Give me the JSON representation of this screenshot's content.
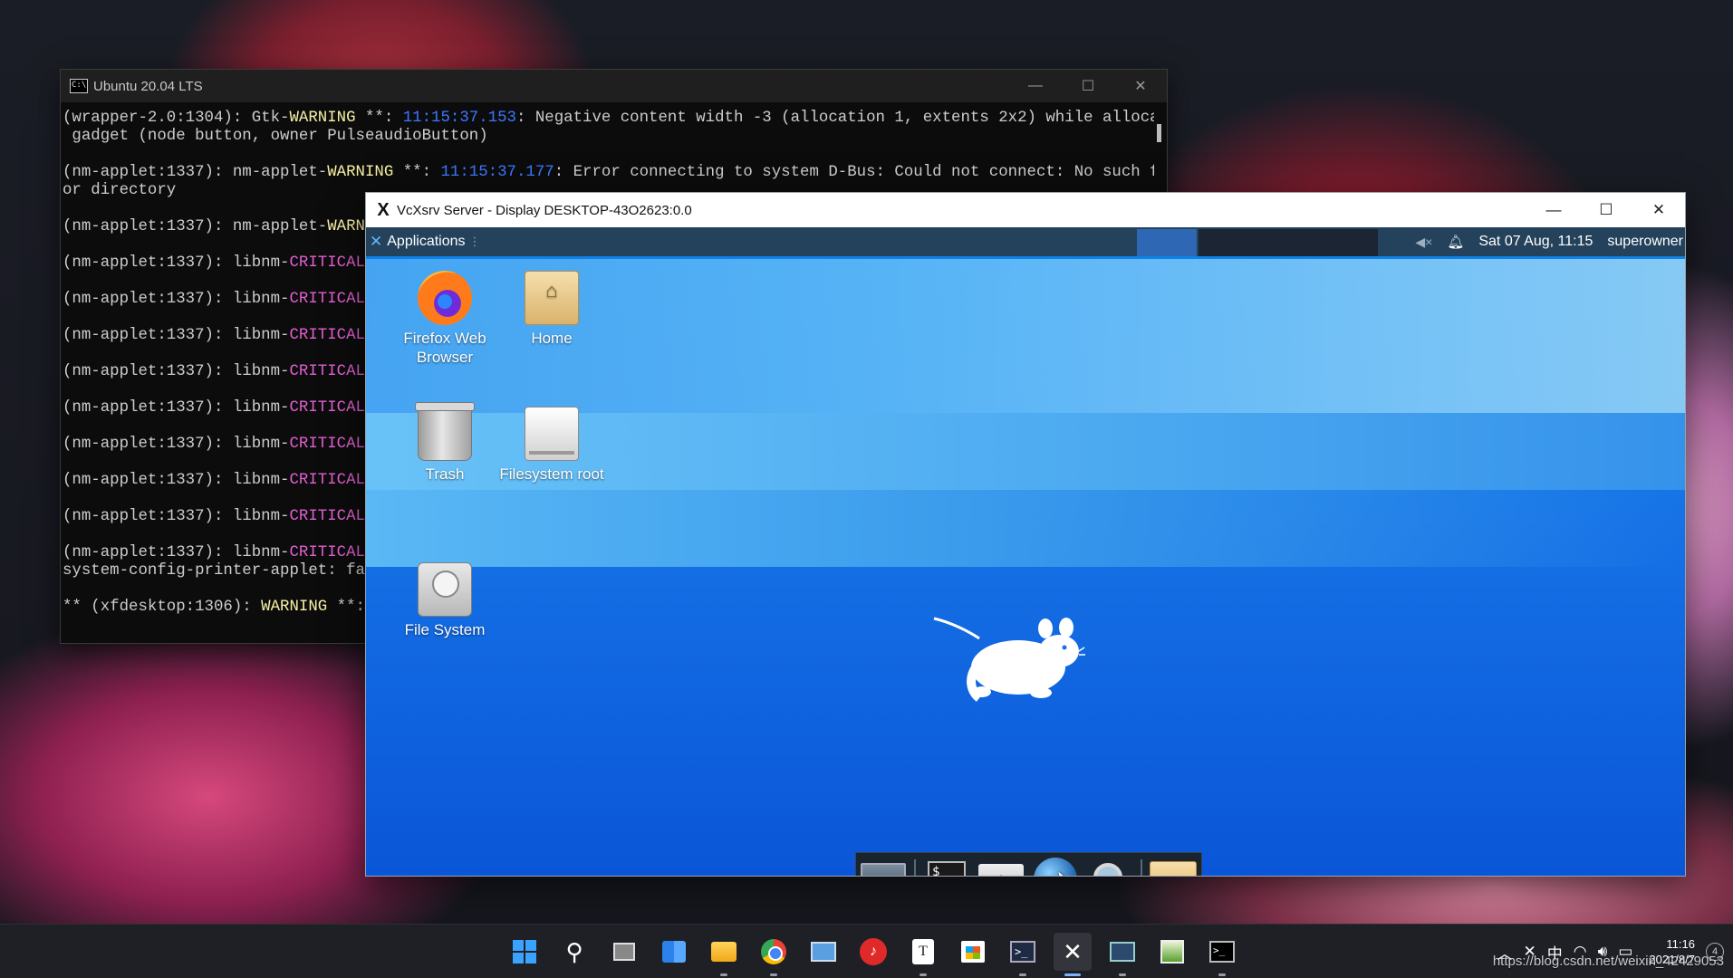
{
  "console": {
    "title": "Ubuntu 20.04 LTS",
    "lines": [
      {
        "a": "(wrapper-2.0:1304): Gtk-",
        "b": "WARNING",
        "c": " **: ",
        "d": "11:15:37.153",
        "e": ": Negative content width -3 (allocation 1, extents 2x2) while allocating"
      },
      {
        "a": " gadget (node button, owner PulseaudioButton)"
      },
      {
        "a": "(nm-applet:1337): nm-applet-",
        "b": "WARNING",
        "c": " **: ",
        "d": "11:15:37.177",
        "e": ": Error connecting to system D-Bus: Could not connect: No such file"
      },
      {
        "a": "or directory"
      },
      {
        "a": "(nm-applet:1337): nm-applet-",
        "b": "WARNIN"
      },
      {
        "a": "(nm-applet:1337): libnm-",
        "m": "CRITICAL",
        "c": " *"
      },
      {
        "a": "(nm-applet:1337): libnm-",
        "m": "CRITICAL",
        "c": " *"
      },
      {
        "a": "(nm-applet:1337): libnm-",
        "m": "CRITICAL",
        "c": " *"
      },
      {
        "a": "(nm-applet:1337): libnm-",
        "m": "CRITICAL",
        "c": " *"
      },
      {
        "a": "(nm-applet:1337): libnm-",
        "m": "CRITICAL",
        "c": " *"
      },
      {
        "a": "(nm-applet:1337): libnm-",
        "m": "CRITICAL",
        "c": " *"
      },
      {
        "a": "(nm-applet:1337): libnm-",
        "m": "CRITICAL",
        "c": " *"
      },
      {
        "a": "(nm-applet:1337): libnm-",
        "m": "CRITICAL",
        "c": " *"
      },
      {
        "a": "(nm-applet:1337): libnm-",
        "m": "CRITICAL",
        "c": " *"
      },
      {
        "a": "system-config-printer-applet: fail"
      },
      {
        "a": "** (xfdesktop:1306): ",
        "b": "WARNING",
        "c": " **: "
      }
    ],
    "gaps_after": [
      1,
      3,
      4,
      5,
      6,
      7,
      8,
      9,
      10,
      11,
      12,
      14
    ]
  },
  "vcxsrv": {
    "title": "VcXsrv Server - Display DESKTOP-43O2623:0.0",
    "panel": {
      "applications_label": "Applications",
      "datetime": "Sat 07 Aug, 11:15",
      "user": "superowner"
    },
    "desktop_icons": [
      {
        "label": "Firefox Web Browser",
        "kind": "firefox-icon"
      },
      {
        "label": "Home",
        "kind": "home-folder-icon"
      },
      {
        "label": "Trash",
        "kind": "trash-icon"
      },
      {
        "label": "Filesystem root",
        "kind": "drive-icon"
      },
      {
        "label": "File System",
        "kind": "hard-disk-icon"
      }
    ],
    "dock": [
      "show-desktop-icon",
      "terminal-icon",
      "file-manager-icon",
      "web-browser-icon",
      "app-finder-icon",
      "folder-icon"
    ]
  },
  "taskbar": {
    "apps": [
      "start-icon",
      "search-icon",
      "task-view-icon",
      "widgets-icon",
      "file-explorer-icon",
      "chrome-icon",
      "remote-desktop-icon",
      "netease-music-icon",
      "typora-icon",
      "store-icon",
      "powershell-icon",
      "vcxsrv-icon",
      "performance-monitor-icon",
      "image-viewer-icon",
      "terminal-icon"
    ],
    "ime": "中",
    "clock_time": "11:16",
    "clock_date": "2021/8/7",
    "notification_count": "4"
  },
  "watermark": "https://blog.csdn.net/weixin_42429053",
  "colors": {
    "console_bg": "#0c0c0c",
    "warning_yellow": "#f9f1a5",
    "timestamp_blue": "#3b78ff",
    "critical_magenta": "#e05fd0",
    "xfce_panel": "#24425b",
    "desktop_blue": "#1672e6"
  }
}
